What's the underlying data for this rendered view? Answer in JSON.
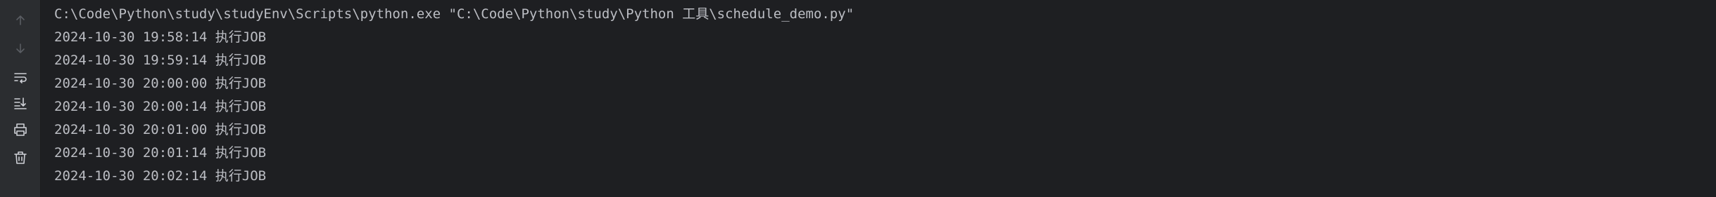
{
  "toolbar": {
    "buttons": [
      {
        "icon": "arrow-up-icon",
        "label": "Up the stack trace",
        "enabled": false
      },
      {
        "icon": "arrow-down-icon",
        "label": "Down the stack trace",
        "enabled": false
      },
      {
        "icon": "soft-wrap-icon",
        "label": "Soft-wrap",
        "enabled": true
      },
      {
        "icon": "scroll-to-end-icon",
        "label": "Scroll to end",
        "enabled": true
      },
      {
        "icon": "print-icon",
        "label": "Print",
        "enabled": true
      },
      {
        "icon": "trash-icon",
        "label": "Clear all",
        "enabled": true
      }
    ]
  },
  "console": {
    "command": "C:\\Code\\Python\\study\\studyEnv\\Scripts\\python.exe \"C:\\Code\\Python\\study\\Python 工具\\schedule_demo.py\"",
    "lines": [
      "2024-10-30 19:58:14 执行JOB",
      "2024-10-30 19:59:14 执行JOB",
      "2024-10-30 20:00:00 执行JOB",
      "2024-10-30 20:00:14 执行JOB",
      "2024-10-30 20:01:00 执行JOB",
      "2024-10-30 20:01:14 执行JOB",
      "2024-10-30 20:02:14 执行JOB"
    ]
  },
  "colors": {
    "background": "#1e1f22",
    "toolbar_background": "#2b2d30",
    "text": "#bcbec4",
    "icon_enabled": "#ced0d6",
    "icon_disabled": "#5a5d63"
  }
}
